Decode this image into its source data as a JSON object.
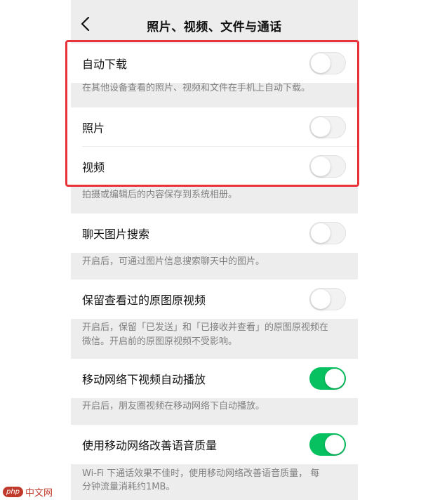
{
  "header": {
    "title": "照片、视频、文件与通话"
  },
  "auto_download": {
    "label": "自动下载",
    "enabled": false,
    "desc": "在其他设备查看的照片、视频和文件在手机上自动下载。"
  },
  "photos": {
    "label": "照片",
    "enabled": false
  },
  "videos": {
    "label": "视频",
    "enabled": false
  },
  "save_desc": "拍摄或编辑后的内容保存到系统相册。",
  "chat_image_search": {
    "label": "聊天图片搜索",
    "enabled": false,
    "desc": "开启后，可通过图片信息搜索聊天中的图片。"
  },
  "keep_originals": {
    "label": "保留查看过的原图原视频",
    "enabled": false,
    "desc_line1": "开启后，保留「已发送」和「已接收并查看」的原图原视频在",
    "desc_line2": "微信。开启前的原图原视频不受影响。"
  },
  "autoplay_mobile": {
    "label": "移动网络下视频自动播放",
    "enabled": true,
    "desc": "开启后，朋友圈视频在移动网络下自动播放。"
  },
  "voice_quality": {
    "label": "使用移动网络改善语音质量",
    "enabled": true,
    "desc_line1": "Wi-Fi 下通话效果不佳时，使用移动网络改善语音质量， 每",
    "desc_line2": "分钟流量消耗约1MB。"
  },
  "watermark": {
    "logo": "php",
    "text": "中文网"
  },
  "colors": {
    "accent": "#07c160",
    "highlight": "#e8333a"
  }
}
